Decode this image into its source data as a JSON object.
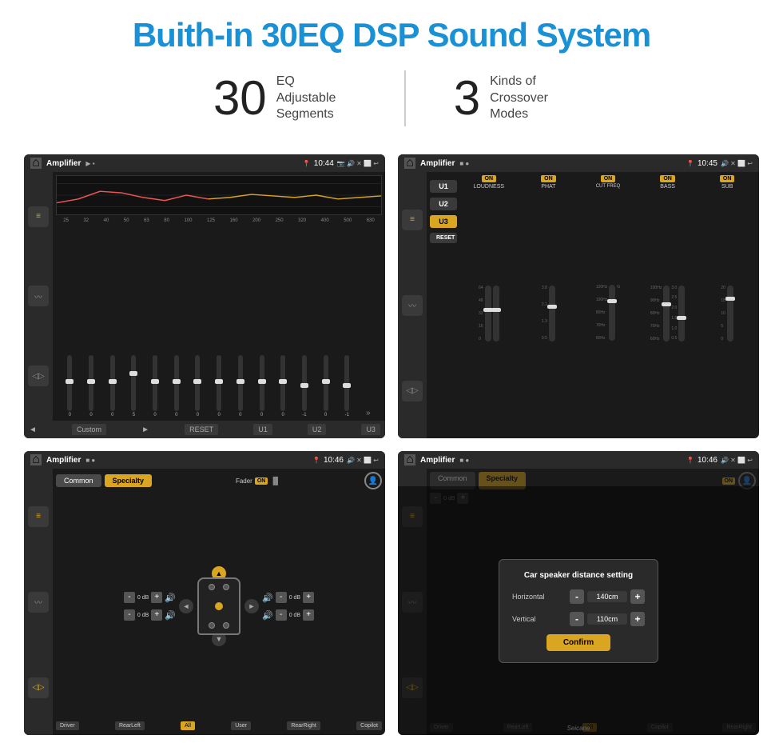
{
  "title": "Buith-in 30EQ DSP Sound System",
  "stats": {
    "eq_number": "30",
    "eq_label": "EQ Adjustable\nSegments",
    "crossover_number": "3",
    "crossover_label": "Kinds of\nCrossover Modes"
  },
  "screens": {
    "top_left": {
      "title": "Amplifier",
      "time": "10:44",
      "eq_bands": [
        "25",
        "32",
        "40",
        "50",
        "63",
        "80",
        "100",
        "125",
        "160",
        "200",
        "250",
        "320",
        "400",
        "500",
        "630"
      ],
      "values": [
        "0",
        "0",
        "0",
        "5",
        "0",
        "0",
        "0",
        "0",
        "0",
        "0",
        "0",
        "-1",
        "0",
        "-1"
      ],
      "presets": [
        "Custom",
        "RESET",
        "U1",
        "U2",
        "U3"
      ]
    },
    "top_right": {
      "title": "Amplifier",
      "time": "10:45",
      "bands": [
        "LOUDNESS",
        "PHAT",
        "CUT FREQ",
        "BASS",
        "SUB"
      ],
      "active_preset": "U3"
    },
    "bottom_left": {
      "title": "Amplifier",
      "time": "10:46",
      "tabs": [
        "Common",
        "Specialty"
      ],
      "active_tab": "Specialty",
      "fader_label": "Fader",
      "fader_on": "ON",
      "vol_controls": [
        {
          "label": "0 dB"
        },
        {
          "label": "0 dB"
        },
        {
          "label": "0 dB"
        },
        {
          "label": "0 dB"
        }
      ],
      "nav_buttons": [
        "Driver",
        "RearLeft",
        "All",
        "User",
        "RearRight",
        "Copilot"
      ]
    },
    "bottom_right": {
      "title": "Amplifier",
      "time": "10:46",
      "tabs": [
        "Common",
        "Specialty"
      ],
      "active_tab": "Specialty",
      "dialog": {
        "title": "Car speaker distance setting",
        "horizontal_label": "Horizontal",
        "horizontal_value": "140cm",
        "vertical_label": "Vertical",
        "vertical_value": "110cm",
        "confirm_label": "Confirm"
      }
    }
  },
  "watermark": "Seicane"
}
